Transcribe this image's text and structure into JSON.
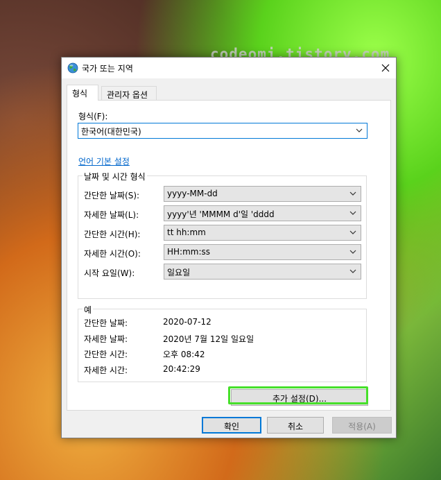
{
  "watermark": "codeomi.tistory.com",
  "window": {
    "title": "국가 또는 지역",
    "icon": "globe-icon"
  },
  "tabs": [
    {
      "label": "형식"
    },
    {
      "label": "관리자 옵션"
    }
  ],
  "format": {
    "label": "형식(F):",
    "value": "한국어(대한민국)"
  },
  "language_link": "언어 기본 설정",
  "datetime_group": {
    "title": "날짜 및 시간 형식",
    "rows": [
      {
        "label": "간단한 날짜(S):",
        "value": "yyyy-MM-dd"
      },
      {
        "label": "자세한 날짜(L):",
        "value": "yyyy'년 'MMMM d'일 'dddd"
      },
      {
        "label": "간단한 시간(H):",
        "value": "tt hh:mm"
      },
      {
        "label": "자세한 시간(O):",
        "value": "HH:mm:ss"
      },
      {
        "label": "시작 요일(W):",
        "value": "일요일"
      }
    ]
  },
  "examples_group": {
    "title": "예",
    "rows": [
      {
        "label": "간단한 날짜:",
        "value": "2020-07-12"
      },
      {
        "label": "자세한 날짜:",
        "value": "2020년 7월 12일 일요일"
      },
      {
        "label": "간단한 시간:",
        "value": "오후 08:42"
      },
      {
        "label": "자세한 시간:",
        "value": "20:42:29"
      }
    ]
  },
  "buttons": {
    "additional": "추가 설정(D)...",
    "ok": "확인",
    "cancel": "취소",
    "apply": "적용(A)"
  },
  "colors": {
    "accent": "#0078d7",
    "highlight": "#46e02a",
    "link": "#0066cc"
  }
}
